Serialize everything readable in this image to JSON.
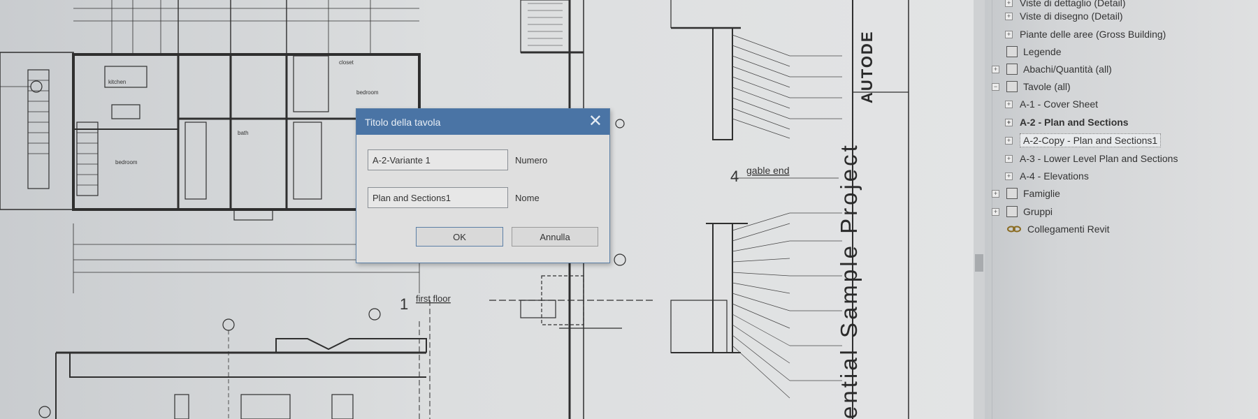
{
  "canvas": {
    "sheet_title": "ential Sample Project",
    "brand": "AUTODE",
    "labels": {
      "first_floor_num": "1",
      "first_floor": "first floor",
      "gable_num": "4",
      "gable": "gable end",
      "kitchen": "kitchen",
      "bedroom1": "bedroom",
      "bedroom2": "bedroom",
      "bath": "bath",
      "closet": "closet"
    }
  },
  "dialog": {
    "title": "Titolo della tavola",
    "close_icon": "close-icon",
    "number_value": "A-2-Variante 1",
    "number_label": "Numero",
    "name_value": "Plan and Sections1",
    "name_label": "Nome",
    "ok_label": "OK",
    "cancel_label": "Annulla"
  },
  "browser": {
    "items": [
      {
        "label": "Viste di dettaglio (Detail)",
        "indent": 2,
        "icon": "expand-icon"
      },
      {
        "label": "Viste di disegno (Detail)",
        "indent": 2,
        "icon": "expand-icon"
      },
      {
        "label": "Piante delle aree (Gross Building)",
        "indent": 2,
        "icon": "expand-icon"
      },
      {
        "label": "Legende",
        "indent": 1,
        "icon": "legend-icon"
      },
      {
        "label": "Abachi/Quantità (all)",
        "indent": 1,
        "icon": "schedule-icon"
      },
      {
        "label": "Tavole (all)",
        "indent": 1,
        "icon": "sheets-icon"
      },
      {
        "label": "A-1 - Cover Sheet",
        "indent": 2,
        "icon": "expand-icon"
      },
      {
        "label": "A-2 - Plan and Sections",
        "indent": 2,
        "icon": "expand-icon",
        "bold": true
      },
      {
        "label": "A-2-Copy - Plan and Sections1",
        "indent": 2,
        "icon": "expand-icon",
        "selected": true
      },
      {
        "label": "A-3 - Lower Level Plan and Sections",
        "indent": 2,
        "icon": "expand-icon"
      },
      {
        "label": "A-4 - Elevations",
        "indent": 2,
        "icon": "expand-icon"
      },
      {
        "label": "Famiglie",
        "indent": 1,
        "icon": "families-icon"
      },
      {
        "label": "Gruppi",
        "indent": 1,
        "icon": "groups-icon"
      },
      {
        "label": "Collegamenti Revit",
        "indent": 1,
        "icon": "revit-links-icon"
      }
    ]
  }
}
